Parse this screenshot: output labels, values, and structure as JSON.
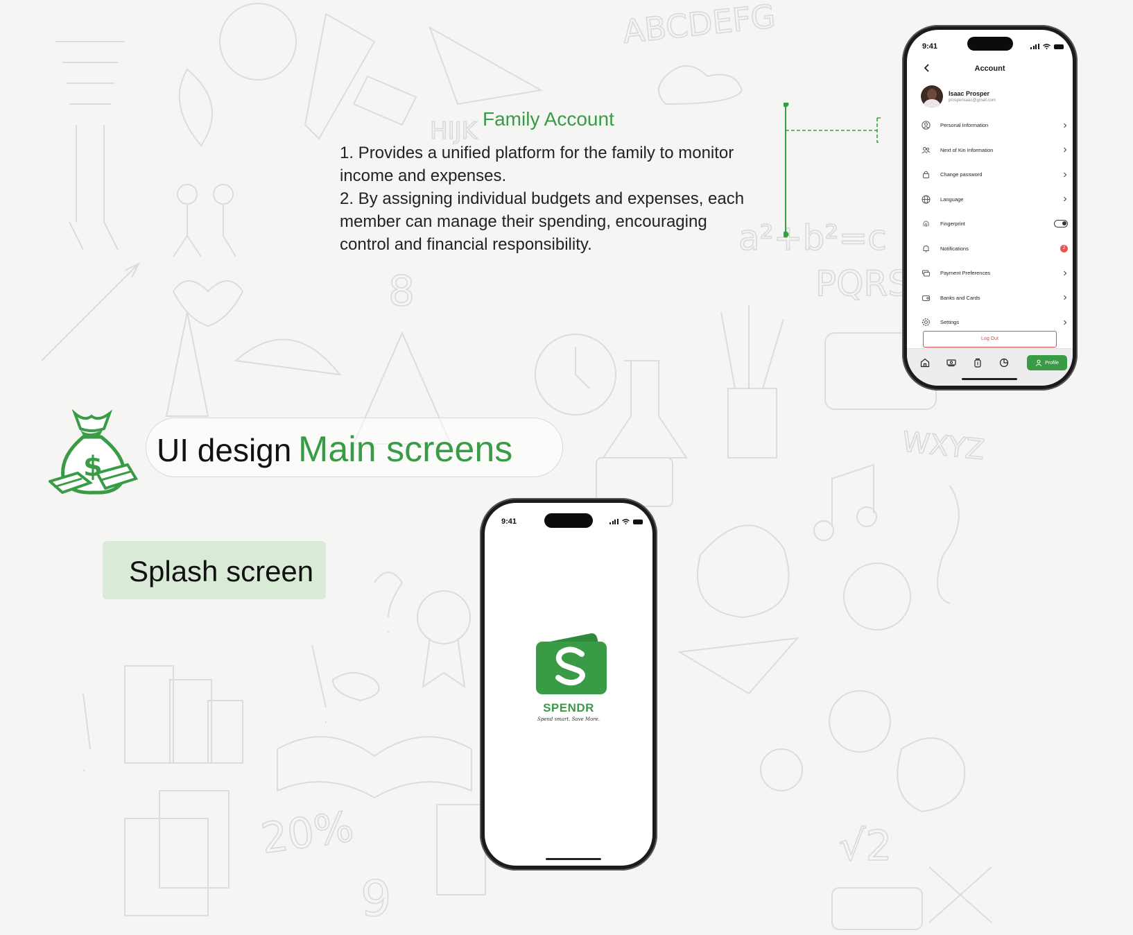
{
  "colors": {
    "accent": "#3a9b46",
    "danger": "#e0454a",
    "background": "#f5f5f4"
  },
  "family_account": {
    "title": "Family Account",
    "lines": [
      " 1. Provides a unified platform for the family to monitor",
      "income and expenses.",
      " 2. By assigning individual budgets and expenses, each",
      "member can manage their spending, encouraging",
      "control and financial responsibility."
    ]
  },
  "account_screen": {
    "status_time": "9:41",
    "header_title": "Account",
    "user": {
      "name": "Isaac Prosper",
      "email": "prosperisaac@gmail.com"
    },
    "menu": [
      {
        "label": "Personal Information",
        "icon": "user-circle-icon",
        "trailing": "chevron"
      },
      {
        "label": "Next of Kin Information",
        "icon": "users-icon",
        "trailing": "chevron"
      },
      {
        "label": "Change password",
        "icon": "lock-icon",
        "trailing": "chevron"
      },
      {
        "label": "Language",
        "icon": "globe-icon",
        "trailing": "chevron"
      },
      {
        "label": "Fingerprint",
        "icon": "fingerprint-icon",
        "trailing": "toggle"
      },
      {
        "label": "Notifications",
        "icon": "bell-icon",
        "trailing": "badge",
        "badge": "2"
      },
      {
        "label": "Payment Preferences",
        "icon": "wallet-icon",
        "trailing": "chevron"
      },
      {
        "label": "Banks and Cards",
        "icon": "card-icon",
        "trailing": "chevron"
      },
      {
        "label": "Settings",
        "icon": "gear-icon",
        "trailing": "chevron"
      }
    ],
    "logout_label": "Log Out",
    "tabs": [
      "home-icon",
      "money-icon",
      "jar-icon",
      "pie-chart-icon"
    ],
    "active_tab_label": "Profile"
  },
  "section": {
    "ui_design": "UI design",
    "main_screens": "Main screens",
    "splash_label": "Splash screen"
  },
  "splash_screen": {
    "status_time": "9:41",
    "brand": "SPENDR",
    "tagline": "Spend smart. Save More."
  }
}
